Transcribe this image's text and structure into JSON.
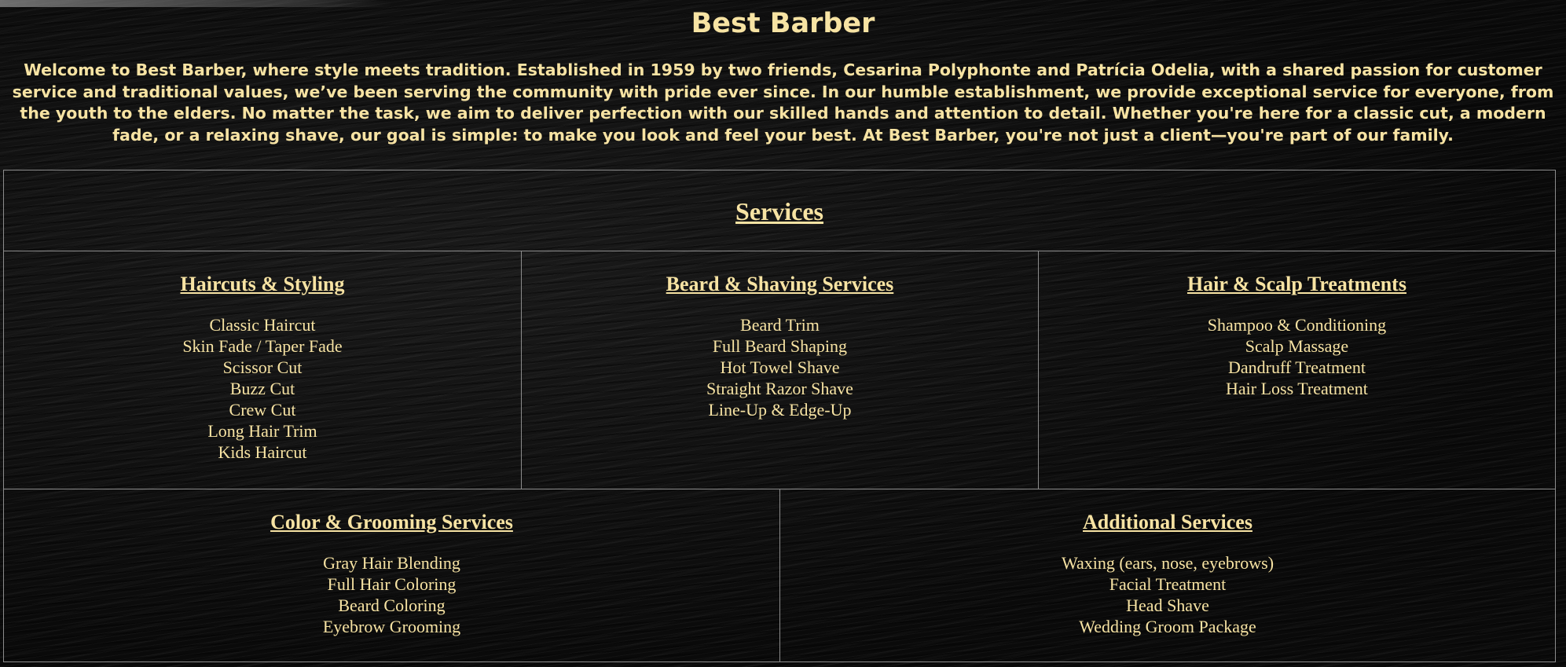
{
  "page": {
    "title": "Best Barber",
    "intro": "Welcome to Best Barber, where style meets tradition. Established in 1959 by two friends, Cesarina Polyphonte and Patrícia Odelia, with a shared passion for customer service and traditional values, we’ve been serving the community with pride ever since. In our humble establishment, we provide exceptional service for everyone, from the youth to the elders. No matter the task, we aim to deliver perfection with our skilled hands and attention to detail. Whether you're here for a classic cut, a modern fade, or a relaxing shave, our goal is simple: to make you look and feel your best. At Best Barber, you're not just a client—you're part of our family."
  },
  "colors": {
    "text": "#f7e3a3",
    "background": "#0e0e0e",
    "border": "#8c8c8c"
  },
  "services": {
    "title": "Services",
    "categories": [
      {
        "title": "Haircuts & Styling",
        "items": [
          "Classic Haircut",
          "Skin Fade / Taper Fade",
          "Scissor Cut",
          "Buzz Cut",
          "Crew Cut",
          "Long Hair Trim",
          "Kids Haircut"
        ]
      },
      {
        "title": "Beard & Shaving Services",
        "items": [
          "Beard Trim",
          "Full Beard Shaping",
          "Hot Towel Shave",
          "Straight Razor Shave",
          "Line-Up & Edge-Up"
        ]
      },
      {
        "title": "Hair & Scalp Treatments",
        "items": [
          "Shampoo & Conditioning",
          "Scalp Massage",
          "Dandruff Treatment",
          "Hair Loss Treatment"
        ]
      },
      {
        "title": "Color & Grooming Services",
        "items": [
          "Gray Hair Blending",
          "Full Hair Coloring",
          "Beard Coloring",
          "Eyebrow Grooming"
        ]
      },
      {
        "title": "Additional Services",
        "items": [
          "Waxing (ears, nose, eyebrows)",
          "Facial Treatment",
          "Head Shave",
          "Wedding Groom Package"
        ]
      }
    ]
  }
}
